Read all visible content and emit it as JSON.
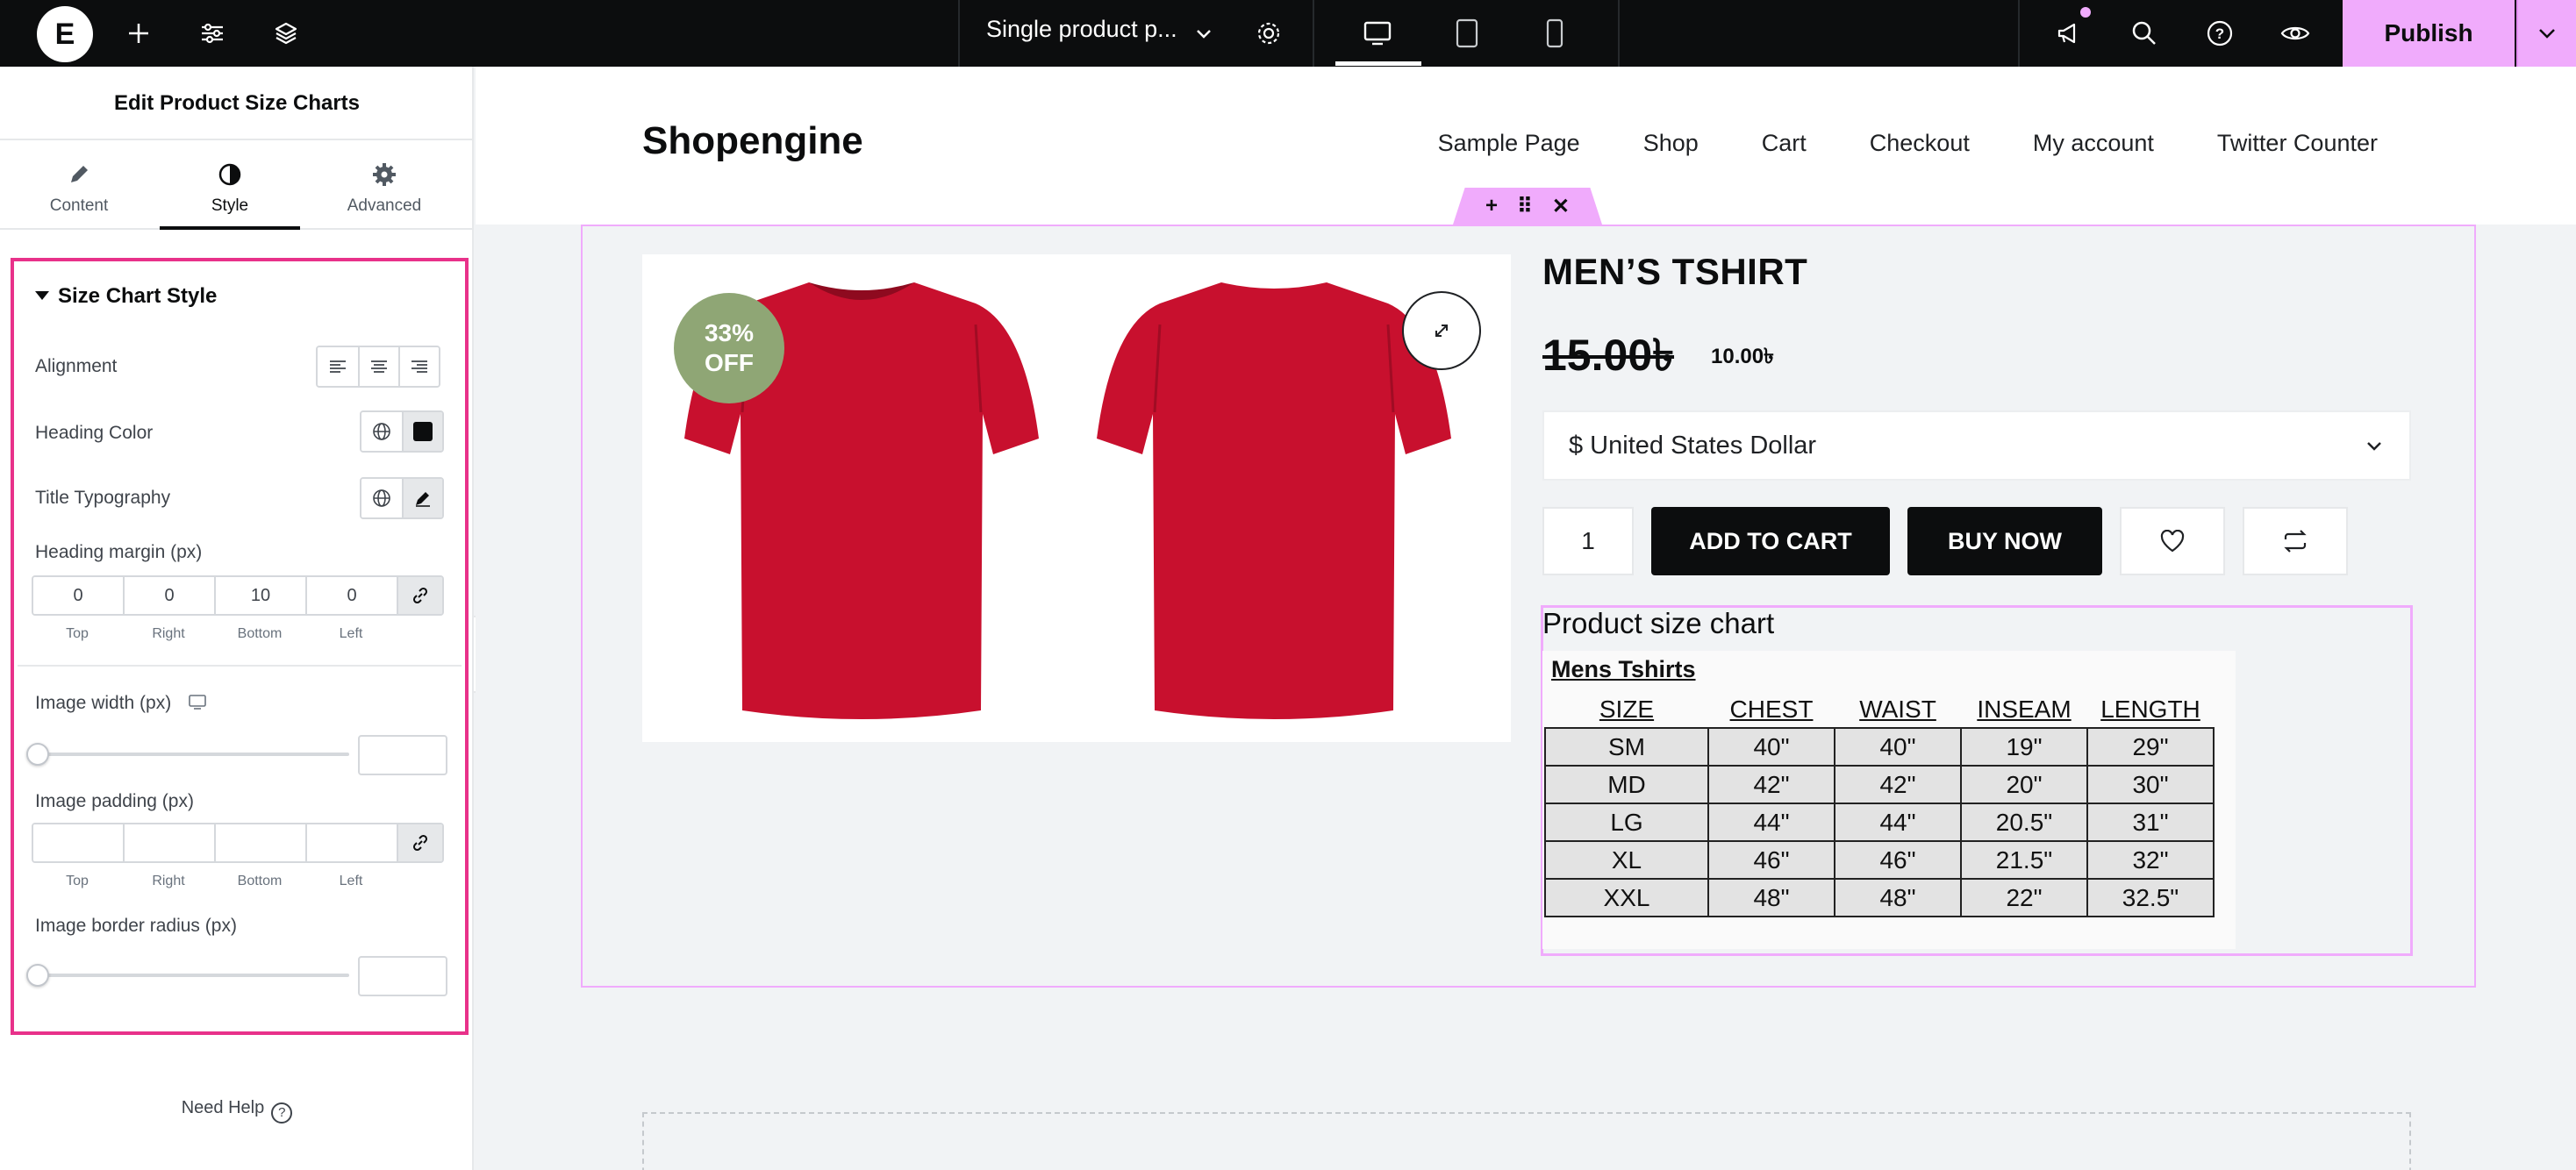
{
  "topbar": {
    "logo": "E",
    "document_title": "Single product p...",
    "publish_label": "Publish"
  },
  "panel": {
    "title": "Edit Product Size Charts",
    "tabs": [
      {
        "label": "Content",
        "icon": "pencil-icon"
      },
      {
        "label": "Style",
        "icon": "half-circle-icon"
      },
      {
        "label": "Advanced",
        "icon": "gear-icon"
      }
    ],
    "section_title": "Size Chart Style",
    "controls": {
      "alignment": "Alignment",
      "heading_color": "Heading Color",
      "title_typography": "Title Typography",
      "heading_margin": "Heading margin (px)",
      "image_width": "Image width (px)",
      "image_padding": "Image padding (px)",
      "image_border_radius": "Image border radius (px)"
    },
    "heading_margin": {
      "top": "0",
      "right": "0",
      "bottom": "10",
      "left": "0"
    },
    "dim_labels": {
      "top": "Top",
      "right": "Right",
      "bottom": "Bottom",
      "left": "Left"
    },
    "need_help": "Need Help",
    "need_help_icon": "?"
  },
  "site": {
    "brand": "Shopengine",
    "nav": [
      "Sample Page",
      "Shop",
      "Cart",
      "Checkout",
      "My account",
      "Twitter Counter"
    ]
  },
  "product": {
    "badge_line1": "33%",
    "badge_line2": "OFF",
    "title": "MEN’S TSHIRT",
    "old_price": "15.00৳",
    "new_price": "10.00৳",
    "currency": "$ United States Dollar",
    "quantity": "1",
    "add_to_cart": "ADD TO CART",
    "buy_now": "BUY NOW"
  },
  "size_chart": {
    "heading": "Product size chart",
    "image_title": "Mens Tshirts",
    "columns": [
      "SIZE",
      "CHEST",
      "WAIST",
      "INSEAM",
      "LENGTH"
    ],
    "rows": [
      [
        "SM",
        "40\"",
        "40\"",
        "19\"",
        "29\""
      ],
      [
        "MD",
        "42\"",
        "42\"",
        "20\"",
        "30\""
      ],
      [
        "LG",
        "44\"",
        "44\"",
        "20.5\"",
        "31\""
      ],
      [
        "XL",
        "46\"",
        "46\"",
        "21.5\"",
        "32\""
      ],
      [
        "XXL",
        "48\"",
        "48\"",
        "22\"",
        "32.5\""
      ]
    ]
  },
  "colors": {
    "accent_pink": "#f0abfc",
    "highlight_border": "#e8318a",
    "badge_green": "#8fa675",
    "shirt_red": "#c8102e"
  }
}
